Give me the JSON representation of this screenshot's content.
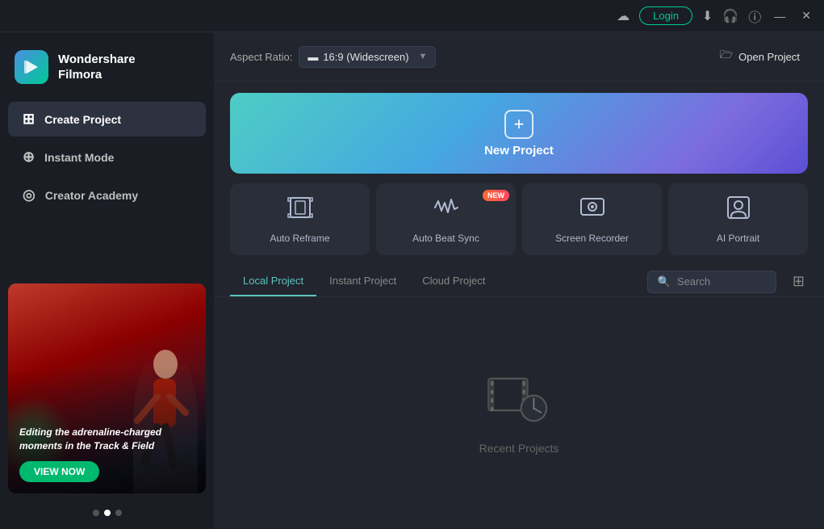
{
  "titlebar": {
    "cloud_icon": "☁",
    "login_label": "Login",
    "download_icon": "⬇",
    "headphone_icon": "🎧",
    "info_icon": "ℹ",
    "minimize_icon": "—",
    "close_icon": "✕"
  },
  "sidebar": {
    "app_name_line1": "Wondershare",
    "app_name_line2": "Filmora",
    "nav_items": [
      {
        "id": "create-project",
        "label": "Create Project",
        "active": true
      },
      {
        "id": "instant-mode",
        "label": "Instant Mode",
        "active": false
      },
      {
        "id": "creator-academy",
        "label": "Creator Academy",
        "active": false
      }
    ],
    "banner": {
      "text": "Editing the adrenaline-charged moments in the Track & Field",
      "btn_label": "VIEW NOW"
    },
    "dots": [
      {
        "active": false
      },
      {
        "active": true
      },
      {
        "active": false
      }
    ]
  },
  "main": {
    "aspect_ratio": {
      "label": "Aspect Ratio:",
      "value": "16:9 (Widescreen)"
    },
    "open_project_label": "Open Project",
    "new_project_label": "New Project",
    "feature_cards": [
      {
        "id": "auto-reframe",
        "label": "Auto Reframe",
        "new": false
      },
      {
        "id": "auto-beat-sync",
        "label": "Auto Beat Sync",
        "new": true
      },
      {
        "id": "screen-recorder",
        "label": "Screen Recorder",
        "new": false
      },
      {
        "id": "ai-portrait",
        "label": "AI Portrait",
        "new": false
      }
    ],
    "new_badge_label": "NEW",
    "tabs": [
      {
        "id": "local",
        "label": "Local Project",
        "active": true
      },
      {
        "id": "instant",
        "label": "Instant Project",
        "active": false
      },
      {
        "id": "cloud",
        "label": "Cloud Project",
        "active": false
      }
    ],
    "search_placeholder": "Search",
    "recent_projects_label": "Recent Projects"
  }
}
